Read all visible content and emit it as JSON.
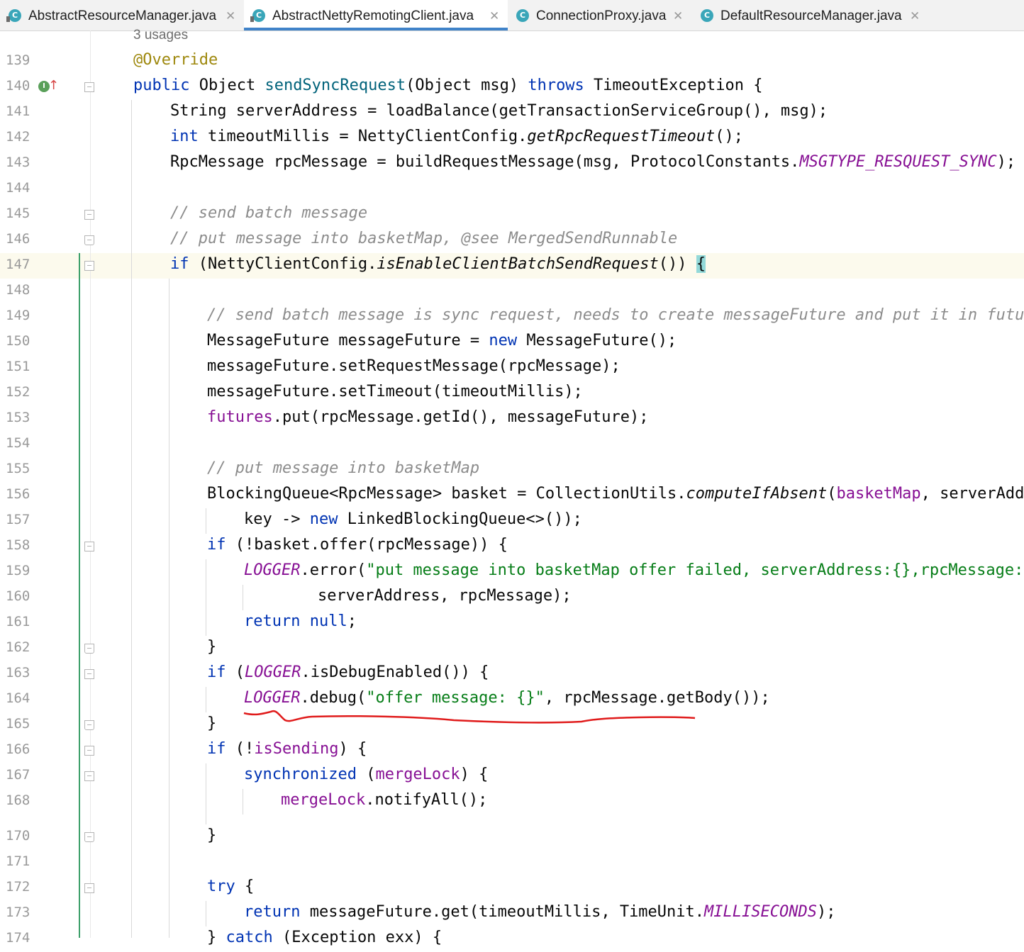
{
  "tabs": [
    {
      "label": "AbstractResourceManager.java",
      "icon": "class-icon",
      "active": false
    },
    {
      "label": "AbstractNettyRemotingClient.java",
      "icon": "class-icon",
      "active": true
    },
    {
      "label": "ConnectionProxy.java",
      "icon": "class-icon",
      "active": false
    },
    {
      "label": "DefaultResourceManager.java",
      "icon": "class-icon",
      "active": false
    }
  ],
  "close_glyph": "✕",
  "usages_hint": "3 usages",
  "colors": {
    "keyword": "#0033b3",
    "method": "#00627a",
    "annotation": "#9e880d",
    "comment": "#8c8c8c",
    "string": "#067d17",
    "field": "#871094",
    "annotation_mark": "#e01b1b",
    "vcs_changed": "#3c9f6a"
  },
  "lines": [
    {
      "num": "139",
      "indent": 0,
      "tokens": [
        [
          "ann",
          "@Override"
        ]
      ]
    },
    {
      "num": "140",
      "indent": 0,
      "tokens": [
        [
          "kw",
          "public"
        ],
        [
          "p",
          " Object "
        ],
        [
          "fn",
          "sendSyncRequest"
        ],
        [
          "p",
          "(Object msg) "
        ],
        [
          "kw",
          "throws"
        ],
        [
          "p",
          " TimeoutException {"
        ]
      ]
    },
    {
      "num": "141",
      "indent": 1,
      "tokens": [
        [
          "p",
          "String serverAddress = loadBalance(getTransactionServiceGroup(), msg);"
        ]
      ]
    },
    {
      "num": "142",
      "indent": 1,
      "tokens": [
        [
          "kw",
          "int"
        ],
        [
          "p",
          " timeoutMillis = NettyClientConfig."
        ],
        [
          "sm",
          "getRpcRequestTimeout"
        ],
        [
          "p",
          "();"
        ]
      ]
    },
    {
      "num": "143",
      "indent": 1,
      "tokens": [
        [
          "p",
          "RpcMessage rpcMessage = buildRequestMessage(msg, ProtocolConstants."
        ],
        [
          "sfld",
          "MSGTYPE_RESQUEST_SYNC"
        ],
        [
          "p",
          ");"
        ]
      ]
    },
    {
      "num": "144",
      "indent": 1,
      "tokens": []
    },
    {
      "num": "145",
      "indent": 1,
      "tokens": [
        [
          "cm",
          "// send batch message"
        ]
      ]
    },
    {
      "num": "146",
      "indent": 1,
      "tokens": [
        [
          "cm",
          "// put message into basketMap, @see MergedSendRunnable"
        ]
      ]
    },
    {
      "num": "147",
      "indent": 1,
      "tokens": [
        [
          "kw",
          "if"
        ],
        [
          "p",
          " (NettyClientConfig."
        ],
        [
          "sm",
          "isEnableClientBatchSendRequest"
        ],
        [
          "p",
          "()) "
        ],
        [
          "hl",
          "{"
        ]
      ]
    },
    {
      "num": "148",
      "indent": 2,
      "tokens": []
    },
    {
      "num": "149",
      "indent": 2,
      "tokens": [
        [
          "cm",
          "// send batch message is sync request, needs to create messageFuture and put it in futures."
        ]
      ]
    },
    {
      "num": "150",
      "indent": 2,
      "tokens": [
        [
          "p",
          "MessageFuture messageFuture = "
        ],
        [
          "kw",
          "new"
        ],
        [
          "p",
          " MessageFuture();"
        ]
      ]
    },
    {
      "num": "151",
      "indent": 2,
      "tokens": [
        [
          "p",
          "messageFuture.setRequestMessage(rpcMessage);"
        ]
      ]
    },
    {
      "num": "152",
      "indent": 2,
      "tokens": [
        [
          "p",
          "messageFuture.setTimeout(timeoutMillis);"
        ]
      ]
    },
    {
      "num": "153",
      "indent": 2,
      "tokens": [
        [
          "fld",
          "futures"
        ],
        [
          "p",
          ".put(rpcMessage.getId(), messageFuture);"
        ]
      ]
    },
    {
      "num": "154",
      "indent": 2,
      "tokens": []
    },
    {
      "num": "155",
      "indent": 2,
      "tokens": [
        [
          "cm",
          "// put message into basketMap"
        ]
      ]
    },
    {
      "num": "156",
      "indent": 2,
      "tokens": [
        [
          "p",
          "BlockingQueue<RpcMessage> basket = CollectionUtils."
        ],
        [
          "sm",
          "computeIfAbsent"
        ],
        [
          "p",
          "("
        ],
        [
          "fld",
          "basketMap"
        ],
        [
          "p",
          ", serverAddress,"
        ]
      ]
    },
    {
      "num": "157",
      "indent": 3,
      "tokens": [
        [
          "p",
          "key -> "
        ],
        [
          "kw",
          "new"
        ],
        [
          "p",
          " LinkedBlockingQueue<>());"
        ]
      ]
    },
    {
      "num": "158",
      "indent": 2,
      "tokens": [
        [
          "kw",
          "if"
        ],
        [
          "p",
          " (!basket.offer(rpcMessage)) {"
        ]
      ]
    },
    {
      "num": "159",
      "indent": 3,
      "tokens": [
        [
          "sfld",
          "LOGGER"
        ],
        [
          "p",
          ".error("
        ],
        [
          "st",
          "\"put message into basketMap offer failed, serverAddress:{},rpcMessage:{}\""
        ],
        [
          "p",
          ","
        ]
      ]
    },
    {
      "num": "160",
      "indent": 5,
      "tokens": [
        [
          "p",
          "serverAddress, rpcMessage);"
        ]
      ]
    },
    {
      "num": "161",
      "indent": 3,
      "tokens": [
        [
          "kw",
          "return"
        ],
        [
          "p",
          " "
        ],
        [
          "kw",
          "null"
        ],
        [
          "p",
          ";"
        ]
      ]
    },
    {
      "num": "162",
      "indent": 2,
      "tokens": [
        [
          "p",
          "}"
        ]
      ]
    },
    {
      "num": "163",
      "indent": 2,
      "tokens": [
        [
          "kw",
          "if"
        ],
        [
          "p",
          " ("
        ],
        [
          "sfld",
          "LOGGER"
        ],
        [
          "p",
          ".isDebugEnabled()) {"
        ]
      ]
    },
    {
      "num": "164",
      "indent": 3,
      "tokens": [
        [
          "sfld",
          "LOGGER"
        ],
        [
          "p",
          ".debug("
        ],
        [
          "st",
          "\"offer message: {}\""
        ],
        [
          "p",
          ", rpcMessage.getBody());"
        ]
      ]
    },
    {
      "num": "165",
      "indent": 2,
      "tokens": [
        [
          "p",
          "}"
        ]
      ]
    },
    {
      "num": "166",
      "indent": 2,
      "tokens": [
        [
          "kw",
          "if"
        ],
        [
          "p",
          " (!"
        ],
        [
          "fld",
          "isSending"
        ],
        [
          "p",
          ") {"
        ]
      ]
    },
    {
      "num": "167",
      "indent": 3,
      "tokens": [
        [
          "kw",
          "synchronized"
        ],
        [
          "p",
          " ("
        ],
        [
          "fld",
          "mergeLock"
        ],
        [
          "p",
          ") {"
        ]
      ]
    },
    {
      "num": "168",
      "indent": 4,
      "tokens": [
        [
          "fld",
          "mergeLock"
        ],
        [
          "p",
          ".notifyAll();"
        ]
      ]
    },
    {
      "num": "170",
      "indent": 2,
      "tokens": [
        [
          "p",
          "}"
        ]
      ]
    },
    {
      "num": "171",
      "indent": 2,
      "tokens": []
    },
    {
      "num": "172",
      "indent": 2,
      "tokens": [
        [
          "kw",
          "try"
        ],
        [
          "p",
          " {"
        ]
      ]
    },
    {
      "num": "173",
      "indent": 3,
      "tokens": [
        [
          "kw",
          "return"
        ],
        [
          "p",
          " messageFuture.get(timeoutMillis, TimeUnit."
        ],
        [
          "sfld",
          "MILLISECONDS"
        ],
        [
          "p",
          ");"
        ]
      ]
    },
    {
      "num": "174",
      "indent": 2,
      "tokens": [
        [
          "p",
          "} "
        ],
        [
          "kw",
          "catch"
        ],
        [
          "p",
          " (Exception exx) {"
        ]
      ]
    }
  ]
}
